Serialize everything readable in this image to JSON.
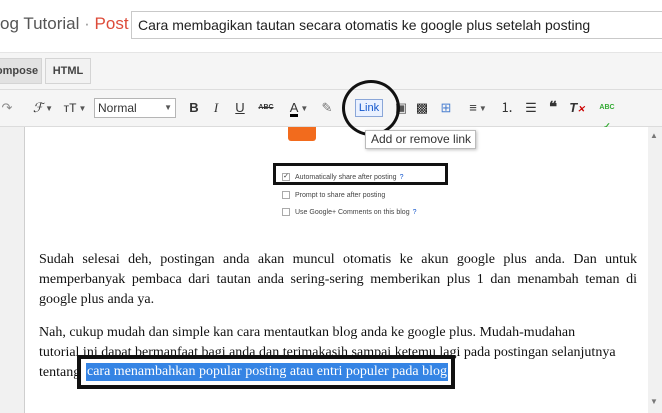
{
  "header": {
    "blog_title": "og Tutorial",
    "separator": "·",
    "section": "Post",
    "post_title": "Cara membagikan tautan secara otomatis ke google plus setelah posting"
  },
  "modes": {
    "compose": "ompose",
    "html": "HTML"
  },
  "toolbar": {
    "font_icon": "ℱ",
    "size_icon": "тT",
    "format_value": "Normal",
    "bold": "B",
    "italic": "I",
    "underline": "U",
    "strike": "ABC",
    "text_color": "A",
    "link_label": "Link",
    "quote": "❝",
    "spell": "ABC",
    "link_tooltip": "Add or remove link"
  },
  "share_options": [
    {
      "label": "Automatically share after posting",
      "help": "?",
      "checked": true
    },
    {
      "label": "Prompt to share after posting",
      "help": "",
      "checked": false
    },
    {
      "label": "Use Google+ Comments on this blog",
      "help": "?",
      "checked": false
    }
  ],
  "content": {
    "paragraph1": "Sudah selesai deh, postingan anda akan muncul otomatis ke akun google plus anda. Dan untuk memperbanyak pembaca dari tautan anda sering-sering memberikan plus 1 dan menambah teman di google plus anda ya.",
    "paragraph2_line1": "Nah, cukup mudah dan simple kan cara mentautkan blog anda ke google plus. Mudah-mudahan",
    "paragraph2_line2": "tutorial ini dapat bermanfaat bagi anda dan terimakasih sampai ketemu lagi pada postingan selanjutnya",
    "paragraph2_line3_start": "tentang",
    "selected_text": "cara menambahkan popular posting atau entri populer pada blog"
  },
  "colors": {
    "accent_orange": "#f26b1d",
    "post_red": "#dd4b39",
    "selection_blue": "#3584e4",
    "link_blue": "#1155cc"
  }
}
